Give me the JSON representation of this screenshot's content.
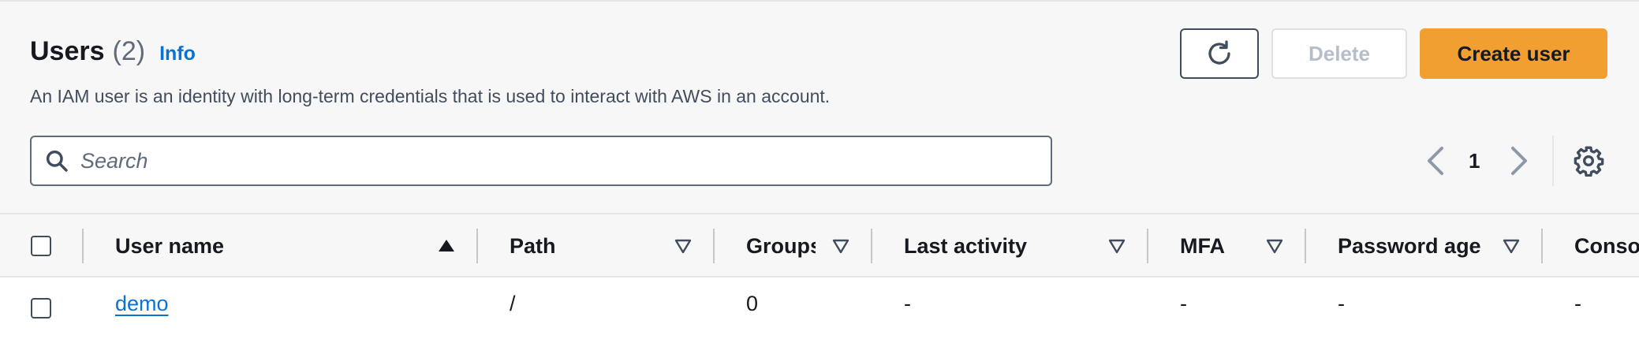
{
  "header": {
    "title": "Users",
    "count": "(2)",
    "info_link": "Info",
    "description": "An IAM user is an identity with long-term credentials that is used to interact with AWS in an account."
  },
  "actions": {
    "refresh_icon": "refresh-icon",
    "delete_label": "Delete",
    "create_label": "Create user"
  },
  "search": {
    "placeholder": "Search",
    "value": ""
  },
  "pagination": {
    "current_page": "1"
  },
  "table": {
    "columns": [
      {
        "label": "User name",
        "sort": "ascending"
      },
      {
        "label": "Path",
        "sort": "none"
      },
      {
        "label": "Groups",
        "sort": "none"
      },
      {
        "label": "Last activity",
        "sort": "none"
      },
      {
        "label": "MFA",
        "sort": "none"
      },
      {
        "label": "Password age",
        "sort": "none"
      },
      {
        "label": "Console",
        "sort": "none"
      }
    ],
    "rows": [
      {
        "user_name": "demo",
        "path": "/",
        "groups": "0",
        "last_activity": "-",
        "mfa": "-",
        "password_age": "-",
        "console": "-"
      }
    ]
  },
  "colors": {
    "accent": "#f29f32",
    "link": "#0972d3",
    "text": "#16191f",
    "muted": "#5f6b7a",
    "background": "#f7f7f7"
  }
}
